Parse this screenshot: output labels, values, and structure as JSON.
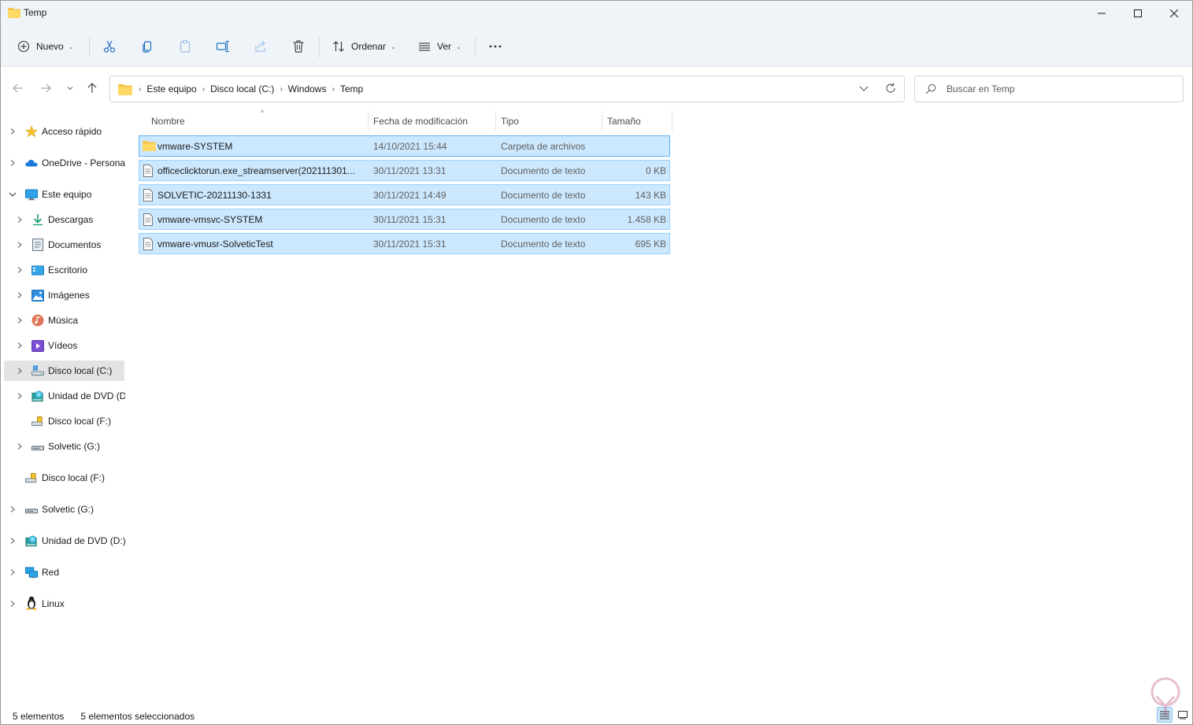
{
  "window": {
    "title": "Temp"
  },
  "toolbar": {
    "new_label": "Nuevo",
    "sort_label": "Ordenar",
    "view_label": "Ver",
    "icons": [
      "cut-icon",
      "copy-icon",
      "paste-icon",
      "rename-icon",
      "share-icon",
      "delete-icon",
      "more-icon"
    ]
  },
  "address": {
    "crumbs": [
      "Este equipo",
      "Disco local (C:)",
      "Windows",
      "Temp"
    ],
    "search_placeholder": "Buscar en Temp"
  },
  "sidebar": {
    "items": [
      {
        "label": "Acceso rápido",
        "icon": "star-icon"
      },
      {
        "label": "OneDrive - Personal",
        "icon": "cloud-icon"
      },
      {
        "label": "Este equipo",
        "icon": "monitor-icon"
      },
      {
        "label": "Descargas",
        "icon": "download-icon"
      },
      {
        "label": "Documentos",
        "icon": "document-icon"
      },
      {
        "label": "Escritorio",
        "icon": "desktop-icon"
      },
      {
        "label": "Imágenes",
        "icon": "pictures-icon"
      },
      {
        "label": "Música",
        "icon": "music-icon"
      },
      {
        "label": "Vídeos",
        "icon": "videos-icon"
      },
      {
        "label": "Disco local (C:)",
        "icon": "drive-c-icon"
      },
      {
        "label": "Unidad de DVD (D:)",
        "icon": "dvd-icon"
      },
      {
        "label": "Disco local (F:)",
        "icon": "usb-drive-icon"
      },
      {
        "label": "Solvetic (G:)",
        "icon": "drive-icon"
      },
      {
        "label": "Disco local (F:)",
        "icon": "usb-drive-icon"
      },
      {
        "label": "Solvetic (G:)",
        "icon": "drive-icon"
      },
      {
        "label": "Unidad de DVD (D:)",
        "icon": "dvd-icon"
      },
      {
        "label": "Red",
        "icon": "network-icon"
      },
      {
        "label": "Linux",
        "icon": "linux-icon"
      }
    ]
  },
  "columns": {
    "name": "Nombre",
    "date": "Fecha de modificación",
    "type": "Tipo",
    "size": "Tamaño"
  },
  "files": [
    {
      "name": "vmware-SYSTEM",
      "date": "14/10/2021 15:44",
      "type": "Carpeta de archivos",
      "size": "",
      "icon": "folder-icon"
    },
    {
      "name": "officeclicktorun.exe_streamserver(202111301...",
      "date": "30/11/2021 13:31",
      "type": "Documento de texto",
      "size": "0 KB",
      "icon": "text-file-icon"
    },
    {
      "name": "SOLVETIC-20211130-1331",
      "date": "30/11/2021 14:49",
      "type": "Documento de texto",
      "size": "143 KB",
      "icon": "text-file-icon"
    },
    {
      "name": "vmware-vmsvc-SYSTEM",
      "date": "30/11/2021 15:31",
      "type": "Documento de texto",
      "size": "1.458 KB",
      "icon": "text-file-icon"
    },
    {
      "name": "vmware-vmusr-SolveticTest",
      "date": "30/11/2021 15:31",
      "type": "Documento de texto",
      "size": "695 KB",
      "icon": "text-file-icon"
    }
  ],
  "status": {
    "count": "5 elementos",
    "selected": "5 elementos seleccionados"
  },
  "colors": {
    "selection": "#cce8ff",
    "selection_border": "#99d1ff",
    "toolbar_bg": "#eff4f9",
    "folder": "#f8c54a",
    "accent": "#0067c0"
  }
}
